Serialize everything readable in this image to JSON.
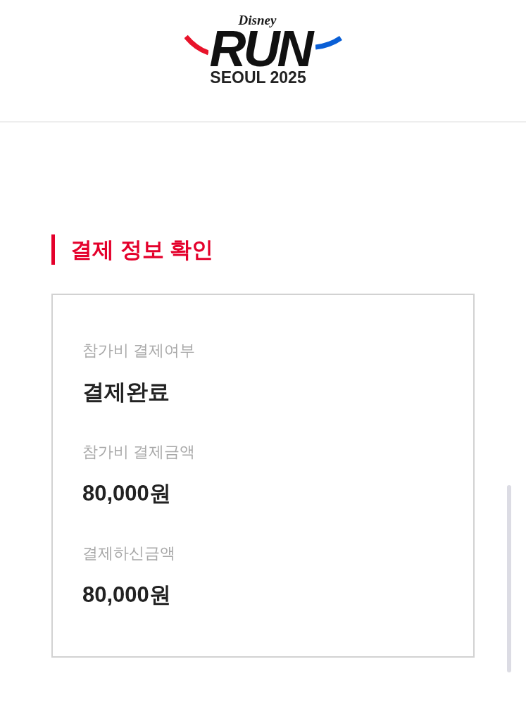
{
  "header": {
    "logo": {
      "brand": "Disney",
      "title": "RUN",
      "subtitle": "SEOUL 2025"
    }
  },
  "section": {
    "title": "결제 정보 확인",
    "fields": [
      {
        "label": "참가비 결제여부",
        "value": "결제완료"
      },
      {
        "label": "참가비 결제금액",
        "value": "80,000원"
      },
      {
        "label": "결제하신금액",
        "value": "80,000원"
      }
    ]
  }
}
